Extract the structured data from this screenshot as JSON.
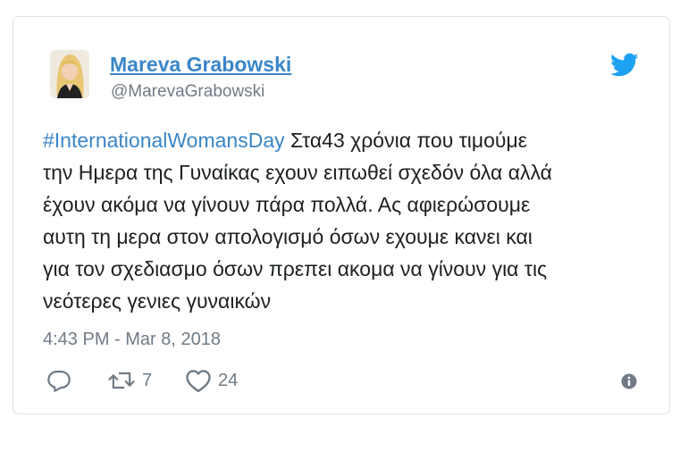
{
  "tweet": {
    "author": {
      "display_name": "Mareva Grabowski",
      "handle": "@MarevaGrabowski",
      "avatar_icon": "profile-photo"
    },
    "hashtag": "#InternationalWomansDay",
    "text_lines": [
      " Στα43 χρόνια που τιμούμε",
      "την Ημερα της Γυναίκας εχουν ειπωθεί σχεδόν όλα αλλά",
      "έχουν ακόμα να γίνουν πάρα πολλά. Ας αφιερώσουμε",
      "αυτη τη μερα στον απολογισμό όσων εχουμε κανει και",
      "για τον σχεδιασμο όσων πρεπει ακομα να γίνουν για τις",
      "νεότερες γενιες γυναικών"
    ],
    "timestamp": "4:43 PM - Mar 8, 2018",
    "actions": {
      "reply_icon": "reply-bubble-icon",
      "retweet_icon": "retweet-icon",
      "retweet_count": "7",
      "like_icon": "heart-icon",
      "like_count": "24",
      "info_icon": "info-icon"
    },
    "brand_icon": "twitter-bird-icon"
  },
  "colors": {
    "link": "#3a86c8",
    "text": "#1c2022",
    "muted": "#707b86",
    "border": "#dfe3e8",
    "twitter_blue": "#1da1f2"
  }
}
